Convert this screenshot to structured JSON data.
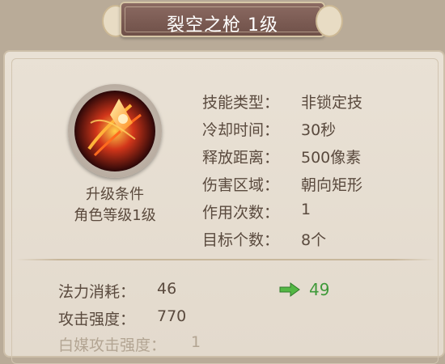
{
  "title": "裂空之枪 1级",
  "colors": {
    "value_up": "#3f9a3a",
    "text": "#5a4a3e",
    "title_bg": "#7a5a52"
  },
  "icon": "skill-lance-icon",
  "requirement": {
    "title": "升级条件",
    "detail": "角色等级1级"
  },
  "info": [
    {
      "label": "技能类型：",
      "value": "非锁定技"
    },
    {
      "label": "冷却时间：",
      "value": "30秒"
    },
    {
      "label": "释放距离：",
      "value": "500像素"
    },
    {
      "label": "伤害区域：",
      "value": "朝向矩形"
    },
    {
      "label": "作用次数：",
      "value": "1"
    },
    {
      "label": "目标个数：",
      "value": "8个"
    }
  ],
  "stats": [
    {
      "label": "法力消耗：",
      "value": "46",
      "next": "49",
      "arrow_icon": "green-arrow-icon"
    },
    {
      "label": "攻击强度：",
      "value": "770"
    },
    {
      "label": "白媒攻击强度：",
      "value": "1"
    }
  ]
}
